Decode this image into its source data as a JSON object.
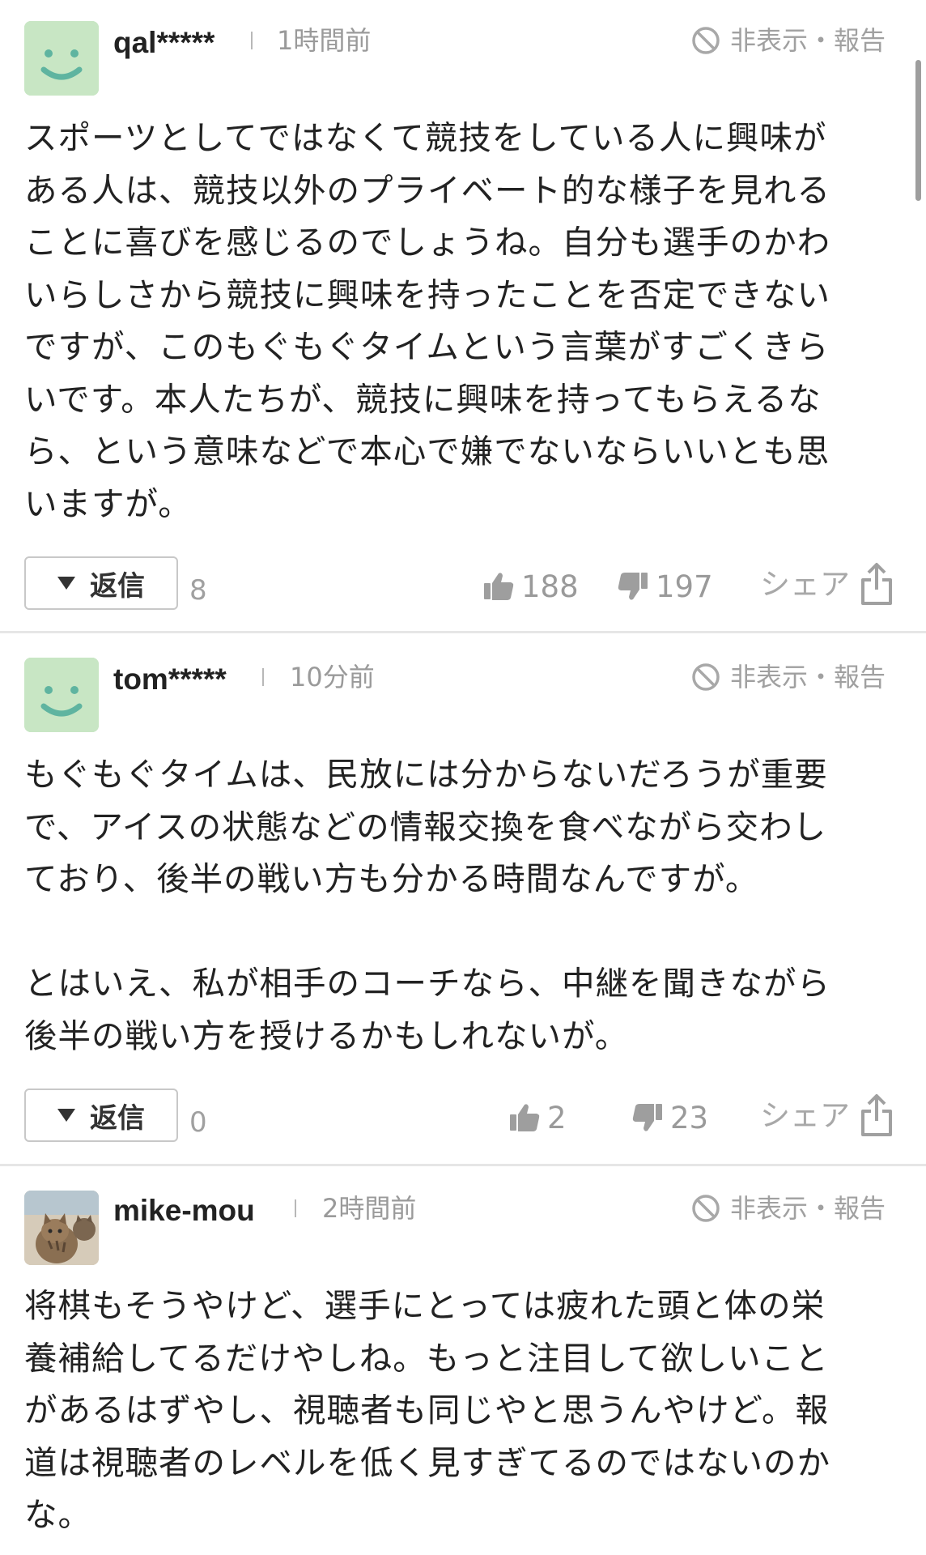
{
  "comments": [
    {
      "username": "qal*****",
      "time": "1時間前",
      "report_label": "非表示・報告",
      "text": "スポーツとしてではなくて競技をしている人に興味が\nある人は、競技以外のプライベート的な様子を見れる\nことに喜びを感じるのでしょうね。自分も選手のかわ\nいらしさから競技に興味を持ったことを否定できない\nですが、このもぐもぐタイムという言葉がすごくきら\nいです。本人たちが、競技に興味を持ってもらえるな\nら、という意味などで本心で嫌でないならいいとも思\nいますが。",
      "reply_label": "返信",
      "reply_count": "8",
      "likes": "188",
      "dislikes": "197",
      "share_label": "シェア"
    },
    {
      "username": "tom*****",
      "time": "10分前",
      "report_label": "非表示・報告",
      "text": "もぐもぐタイムは、民放には分からないだろうが重要\nで、アイスの状態などの情報交換を食べながら交わし\nており、後半の戦い方も分かる時間なんですが。\n\nとはいえ、私が相手のコーチなら、中継を聞きながら\n後半の戦い方を授けるかもしれないが。",
      "reply_label": "返信",
      "reply_count": "0",
      "likes": "2",
      "dislikes": "23",
      "share_label": "シェア"
    },
    {
      "username": "mike-mou",
      "time": "2時間前",
      "report_label": "非表示・報告",
      "text": "将棋もそうやけど、選手にとっては疲れた頭と体の栄\n養補給してるだけやしね。もっと注目して欲しいこと\nがあるはずやし、視聴者も同じやと思うんやけど。報\n道は視聴者のレベルを低く見すぎてるのではないのか\nな。"
    }
  ],
  "colors": {
    "avatar_bg": "#c8e6c4",
    "avatar_face": "#5fb4a0",
    "muted_text": "#9a9a9a",
    "divider": "#e6e6e6"
  },
  "icons": {
    "report": "prohibited-icon",
    "like": "thumbs-up-icon",
    "dislike": "thumbs-down-icon",
    "share": "share-icon",
    "reply": "triangle-down-icon"
  }
}
